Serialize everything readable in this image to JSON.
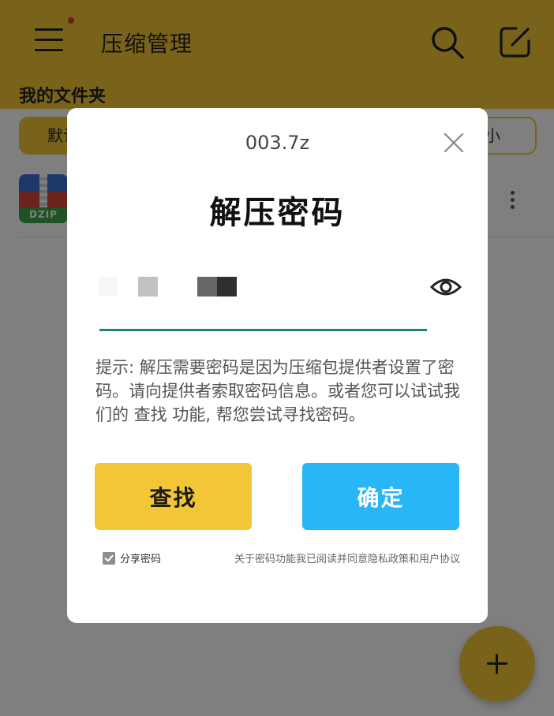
{
  "app": {
    "title": "压缩管理",
    "section_title": "我的文件夹",
    "filter_default": "默认",
    "filter_size": "大小",
    "file_icon_label": "DZIP",
    "icons": [
      "menu-icon",
      "search-icon",
      "edit-icon",
      "more-vertical-icon",
      "plus-icon"
    ],
    "accent_color": "#f3c637"
  },
  "dialog": {
    "filename": "003.7z",
    "title": "解压密码",
    "hint": "提示: 解压需要密码是因为压缩包提供者设置了密码。请向提供者索取密码信息。或者您可以试试我们的 查找 功能, 帮您尝试寻找密码。",
    "find_label": "查找",
    "ok_label": "确定",
    "share_label": "分享密码",
    "share_checked": true,
    "agreement_text": "关于密码功能我已阅读并同意隐私政策和用户协议",
    "find_color": "#f3c637",
    "ok_color": "#29b6f6",
    "underline_color": "#18867a"
  }
}
